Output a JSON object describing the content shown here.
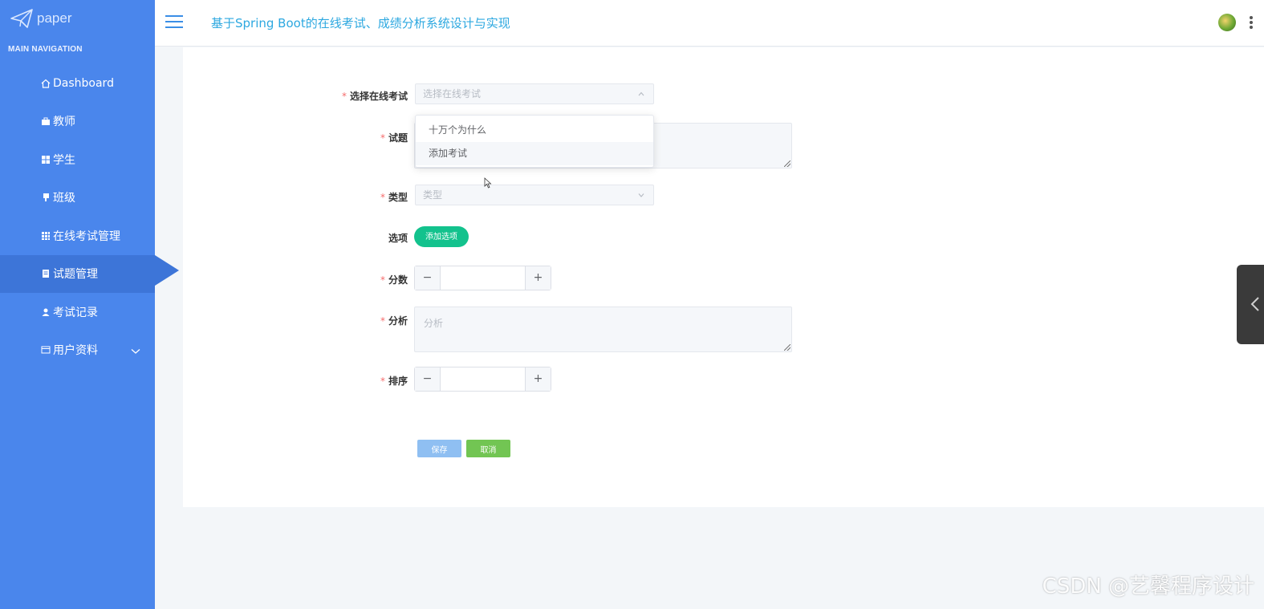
{
  "brand": {
    "name": "paper"
  },
  "nav": {
    "heading": "MAIN NAVIGATION",
    "items": [
      {
        "label": "Dashboard",
        "icon": "home-icon"
      },
      {
        "label": "教师",
        "icon": "briefcase-icon"
      },
      {
        "label": "学生",
        "icon": "grid-icon"
      },
      {
        "label": "班级",
        "icon": "flag-icon"
      },
      {
        "label": "在线考试管理",
        "icon": "table-icon"
      },
      {
        "label": "试题管理",
        "icon": "document-icon",
        "active": true
      },
      {
        "label": "考试记录",
        "icon": "user-icon"
      },
      {
        "label": "用户资料",
        "icon": "card-icon",
        "expandable": true
      }
    ]
  },
  "header": {
    "title": "基于Spring Boot的在线考试、成绩分析系统设计与实现"
  },
  "form": {
    "exam": {
      "label": "选择在线考试",
      "placeholder": "选择在线考试",
      "options": [
        "十万个为什么",
        "添加考试"
      ]
    },
    "question": {
      "label": "试题"
    },
    "type": {
      "label": "类型",
      "placeholder": "类型"
    },
    "options": {
      "label": "选项",
      "add_button": "添加选项"
    },
    "score": {
      "label": "分数",
      "minus": "−",
      "plus": "+"
    },
    "analysis": {
      "label": "分析",
      "placeholder": "分析"
    },
    "order": {
      "label": "排序",
      "minus": "−",
      "plus": "+"
    },
    "save": "保存",
    "cancel": "取消"
  },
  "watermark": "CSDN @艺馨程序设计",
  "colors": {
    "sidebar": "#4a86ec",
    "title": "#2da8e0",
    "pill": "#13c28d",
    "save": "#8fbff2",
    "cancel": "#72c553",
    "required": "#f56c6c"
  }
}
